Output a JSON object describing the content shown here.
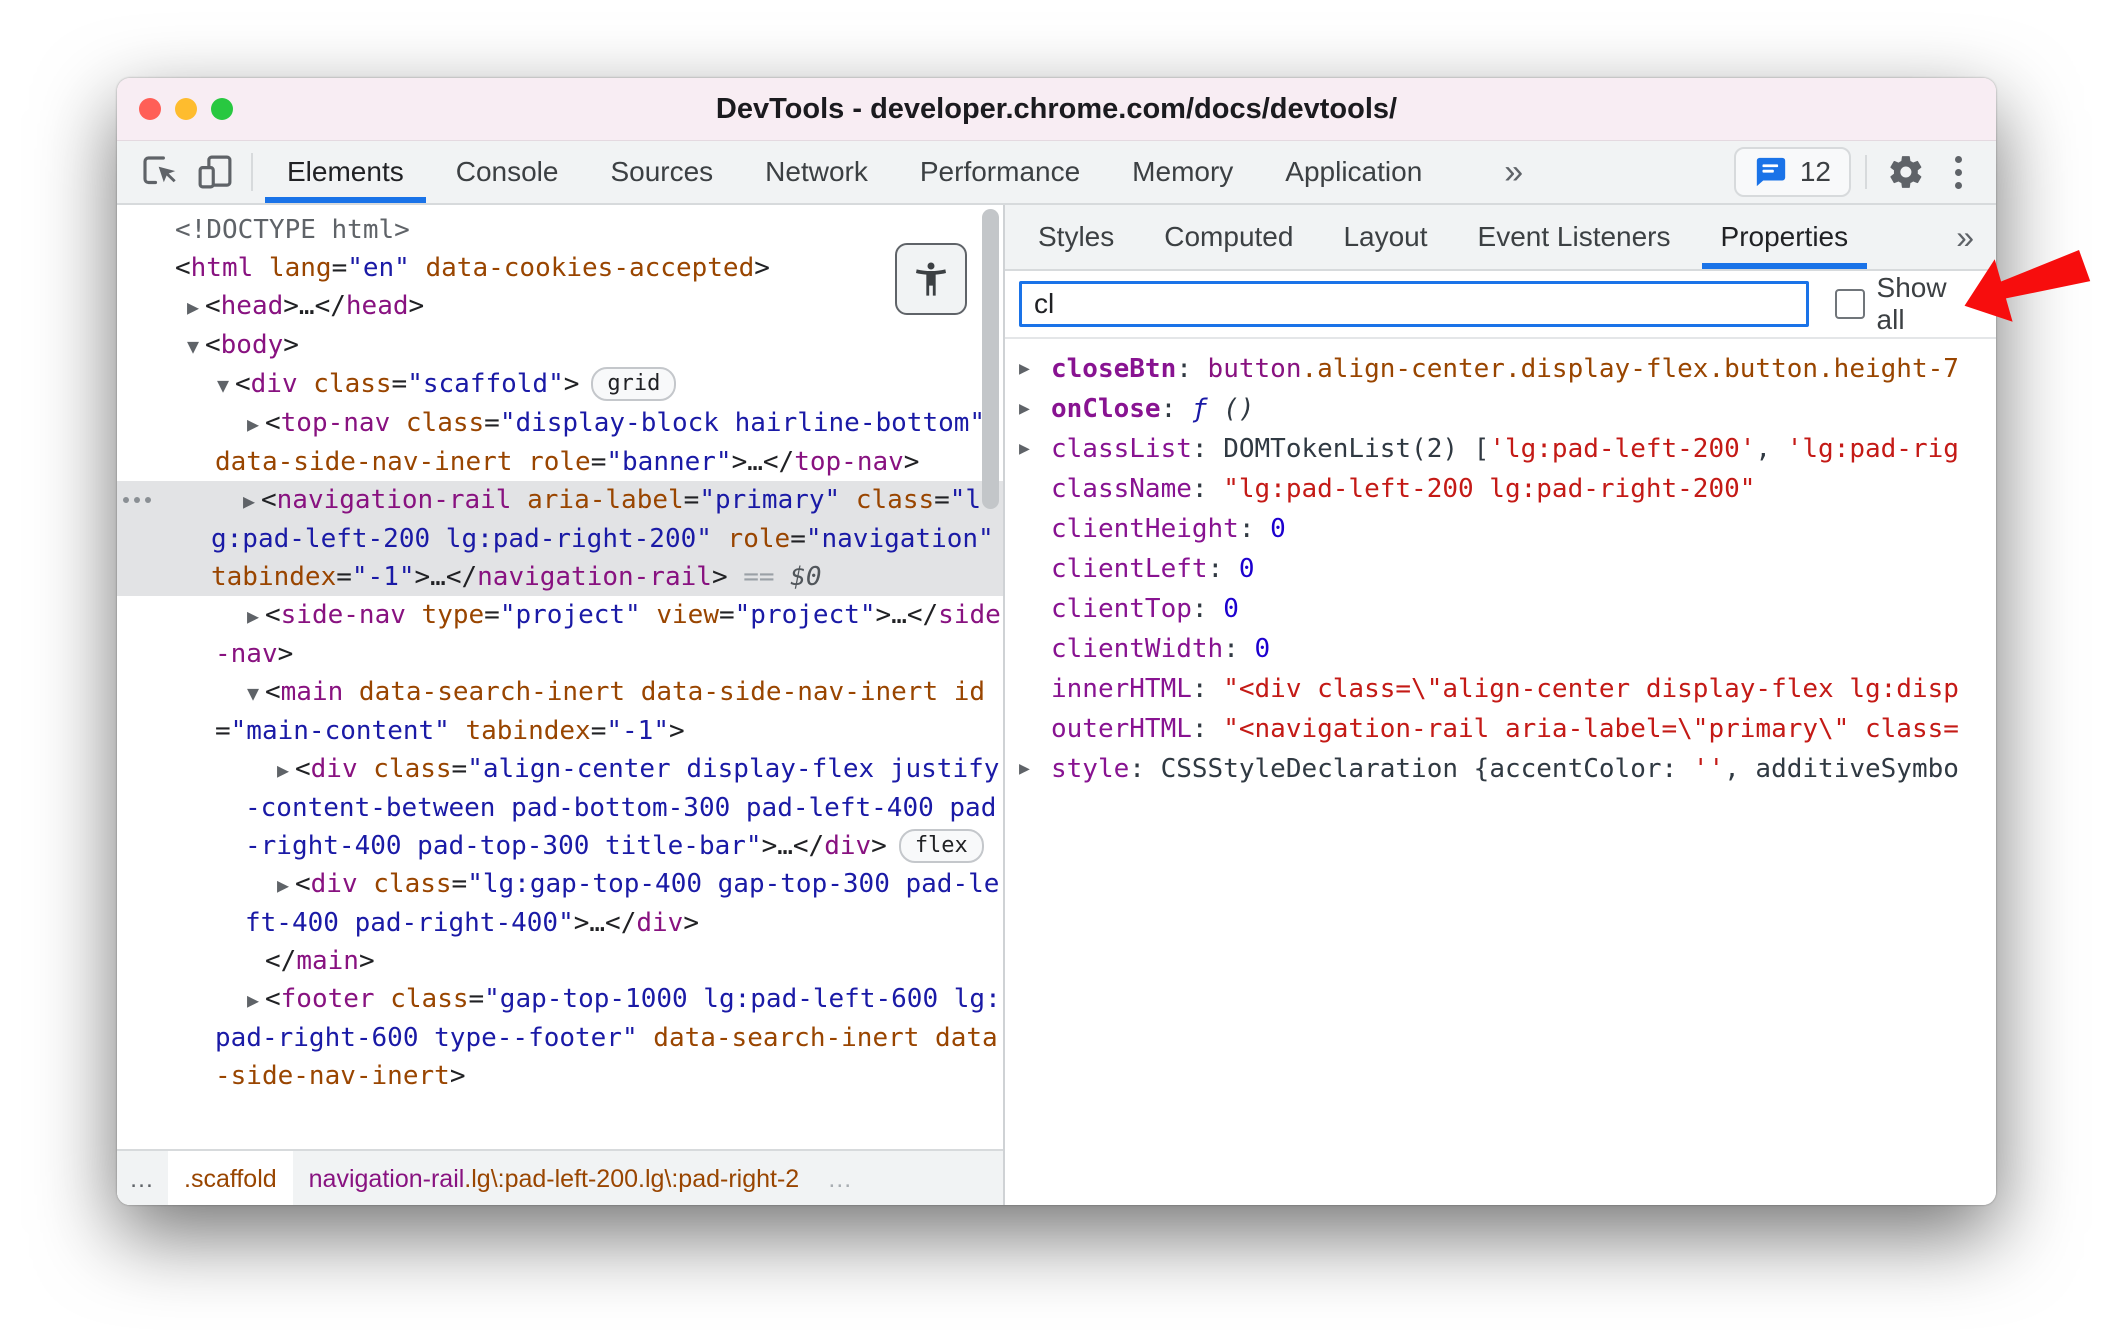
{
  "window": {
    "title": "DevTools - developer.chrome.com/docs/devtools/",
    "traffic_lights": [
      "close",
      "minimize",
      "zoom"
    ]
  },
  "devtools_toolbar": {
    "tabs": [
      "Elements",
      "Console",
      "Sources",
      "Network",
      "Performance",
      "Memory",
      "Application"
    ],
    "active_tab": "Elements",
    "more_tabs_glyph": "»",
    "messages_count": "12"
  },
  "elements_panel": {
    "tree": [
      {
        "level": 0,
        "arrow": "none",
        "parts": [
          [
            "g",
            "<!DOCTYPE html>"
          ]
        ]
      },
      {
        "level": 0,
        "arrow": "none",
        "parts": [
          [
            "p",
            "<"
          ],
          [
            "t",
            "html"
          ],
          [
            "a",
            " lang"
          ],
          [
            "p",
            "="
          ],
          [
            "v",
            "\"en\""
          ],
          [
            "a",
            " data-cookies-accepted"
          ],
          [
            "p",
            ">"
          ]
        ]
      },
      {
        "level": 1,
        "arrow": "closed",
        "parts": [
          [
            "p",
            "<"
          ],
          [
            "t",
            "head"
          ],
          [
            "p",
            ">…"
          ],
          [
            "p",
            "</"
          ],
          [
            "t",
            "head"
          ],
          [
            "p",
            ">"
          ]
        ]
      },
      {
        "level": 1,
        "arrow": "open",
        "parts": [
          [
            "p",
            "<"
          ],
          [
            "t",
            "body"
          ],
          [
            "p",
            ">"
          ]
        ]
      },
      {
        "level": 2,
        "arrow": "open",
        "badge": "grid",
        "parts": [
          [
            "p",
            "<"
          ],
          [
            "t",
            "div"
          ],
          [
            "a",
            " class"
          ],
          [
            "p",
            "="
          ],
          [
            "v",
            "\"scaffold\""
          ],
          [
            "p",
            ">"
          ]
        ]
      },
      {
        "level": 3,
        "arrow": "closed",
        "parts": [
          [
            "p",
            "<"
          ],
          [
            "t",
            "top-nav"
          ],
          [
            "a",
            " class"
          ],
          [
            "p",
            "="
          ],
          [
            "v",
            "\"display-block hairline-bottom\""
          ],
          [
            "a",
            " data-side-nav-inert"
          ],
          [
            "a",
            " role"
          ],
          [
            "p",
            "="
          ],
          [
            "v",
            "\"banner\""
          ],
          [
            "p",
            ">…"
          ],
          [
            "p",
            "</"
          ],
          [
            "t",
            "top-nav"
          ],
          [
            "p",
            ">"
          ]
        ]
      },
      {
        "level": 3,
        "arrow": "closed",
        "selected": true,
        "gutter": true,
        "suffix": [
          "==",
          "$0"
        ],
        "parts": [
          [
            "p",
            "<"
          ],
          [
            "t",
            "navigation-rail"
          ],
          [
            "a",
            " aria-label"
          ],
          [
            "p",
            "="
          ],
          [
            "v",
            "\"primary\""
          ],
          [
            "a",
            " class"
          ],
          [
            "p",
            "="
          ],
          [
            "v",
            "\"lg:pad-left-200 lg:pad-right-200\""
          ],
          [
            "a",
            " role"
          ],
          [
            "p",
            "="
          ],
          [
            "v",
            "\"navigation\""
          ],
          [
            "a",
            " tabindex"
          ],
          [
            "p",
            "="
          ],
          [
            "v",
            "\"-1\""
          ],
          [
            "p",
            ">…"
          ],
          [
            "p",
            "</"
          ],
          [
            "t",
            "navigation-rail"
          ],
          [
            "p",
            ">"
          ]
        ]
      },
      {
        "level": 3,
        "arrow": "closed",
        "parts": [
          [
            "p",
            "<"
          ],
          [
            "t",
            "side-nav"
          ],
          [
            "a",
            " type"
          ],
          [
            "p",
            "="
          ],
          [
            "v",
            "\"project\""
          ],
          [
            "a",
            " view"
          ],
          [
            "p",
            "="
          ],
          [
            "v",
            "\"project\""
          ],
          [
            "p",
            ">…"
          ],
          [
            "p",
            "</"
          ],
          [
            "t",
            "side-nav"
          ],
          [
            "p",
            ">"
          ]
        ]
      },
      {
        "level": 3,
        "arrow": "open",
        "parts": [
          [
            "p",
            "<"
          ],
          [
            "t",
            "main"
          ],
          [
            "a",
            " data-search-inert"
          ],
          [
            "a",
            " data-side-nav-inert"
          ],
          [
            "a",
            " id"
          ],
          [
            "p",
            "="
          ],
          [
            "v",
            "\"main-content\""
          ],
          [
            "a",
            " tabindex"
          ],
          [
            "p",
            "="
          ],
          [
            "v",
            "\"-1\""
          ],
          [
            "p",
            ">"
          ]
        ]
      },
      {
        "level": 4,
        "arrow": "closed",
        "badge": "flex",
        "parts": [
          [
            "p",
            "<"
          ],
          [
            "t",
            "div"
          ],
          [
            "a",
            " class"
          ],
          [
            "p",
            "="
          ],
          [
            "v",
            "\"align-center display-flex justify-content-between pad-bottom-300 pad-left-400 pad-right-400 pad-top-300 title-bar\""
          ],
          [
            "p",
            ">…"
          ],
          [
            "p",
            "</"
          ],
          [
            "t",
            "div"
          ],
          [
            "p",
            ">"
          ]
        ]
      },
      {
        "level": 4,
        "arrow": "closed",
        "parts": [
          [
            "p",
            "<"
          ],
          [
            "t",
            "div"
          ],
          [
            "a",
            " class"
          ],
          [
            "p",
            "="
          ],
          [
            "v",
            "\"lg:gap-top-400 gap-top-300 pad-left-400 pad-right-400\""
          ],
          [
            "p",
            ">…"
          ],
          [
            "p",
            "</"
          ],
          [
            "t",
            "div"
          ],
          [
            "p",
            ">"
          ]
        ]
      },
      {
        "level": 3,
        "arrow": "none",
        "parts": [
          [
            "p",
            "</"
          ],
          [
            "t",
            "main"
          ],
          [
            "p",
            ">"
          ]
        ]
      },
      {
        "level": 3,
        "arrow": "closed",
        "parts": [
          [
            "p",
            "<"
          ],
          [
            "t",
            "footer"
          ],
          [
            "a",
            " class"
          ],
          [
            "p",
            "="
          ],
          [
            "v",
            "\"gap-top-1000 lg:pad-left-600 lg:pad-right-600 type--footer\""
          ],
          [
            "a",
            " data-search-inert"
          ],
          [
            "a",
            " data-side-nav-inert"
          ],
          [
            "p",
            ">"
          ]
        ]
      }
    ],
    "breadcrumbs": {
      "items": [
        {
          "kind": "ellipsis",
          "text": "…"
        },
        {
          "kind": "crumb",
          "highlight": true,
          "parts": [
            [
              "a",
              ".scaffold"
            ]
          ]
        },
        {
          "kind": "crumb",
          "parts": [
            [
              "t",
              "navigation-rail"
            ],
            [
              "a",
              ".lg\\:pad-left-200.lg\\:pad-right-2"
            ]
          ]
        },
        {
          "kind": "ellipsis-muted",
          "text": "…"
        }
      ]
    }
  },
  "sidebar": {
    "tabs": [
      "Styles",
      "Computed",
      "Layout",
      "Event Listeners",
      "Properties"
    ],
    "active_tab": "Properties",
    "more_tabs_glyph": "»",
    "filter": {
      "value": "cl"
    },
    "show_all": {
      "label": "Show all",
      "checked": false
    },
    "properties": [
      {
        "name": "closeBtn",
        "own": true,
        "expandable": true,
        "value": [
          [
            "pv-t",
            "button"
          ],
          [
            "pv-a",
            ".align-center.display-flex.button.height-7"
          ]
        ]
      },
      {
        "name": "onClose",
        "own": true,
        "expandable": true,
        "value": [
          [
            "pv-fn",
            "ƒ"
          ],
          [
            "pv-di",
            " ()"
          ]
        ]
      },
      {
        "name": "classList",
        "expandable": true,
        "value": [
          [
            "pv-d",
            "DOMTokenList(2) ["
          ],
          [
            "pv-s",
            "'lg:pad-left-200'"
          ],
          [
            "pv-d",
            ", "
          ],
          [
            "pv-s",
            "'lg:pad-rig"
          ]
        ]
      },
      {
        "name": "className",
        "value": [
          [
            "pv-s",
            "\"lg:pad-left-200 lg:pad-right-200\""
          ]
        ]
      },
      {
        "name": "clientHeight",
        "value": [
          [
            "pv-n",
            "0"
          ]
        ]
      },
      {
        "name": "clientLeft",
        "value": [
          [
            "pv-n",
            "0"
          ]
        ]
      },
      {
        "name": "clientTop",
        "value": [
          [
            "pv-n",
            "0"
          ]
        ]
      },
      {
        "name": "clientWidth",
        "value": [
          [
            "pv-n",
            "0"
          ]
        ]
      },
      {
        "name": "innerHTML",
        "value": [
          [
            "pv-s",
            "\"<div class=\\\"align-center display-flex lg:disp"
          ]
        ]
      },
      {
        "name": "outerHTML",
        "value": [
          [
            "pv-s",
            "\"<navigation-rail aria-label=\\\"primary\\\" class="
          ]
        ]
      },
      {
        "name": "style",
        "expandable": true,
        "value": [
          [
            "pv-d",
            "CSSStyleDeclaration {accentColor: "
          ],
          [
            "pv-s",
            "''"
          ],
          [
            "pv-d",
            ", additiveSymbo"
          ]
        ]
      }
    ]
  },
  "colors": {
    "accent": "#1a73e8",
    "traffic": [
      "#ff5f57",
      "#febc2e",
      "#28c840"
    ],
    "annotation_arrow": "#f70d0d",
    "tag": "#881280",
    "attr_name": "#994500",
    "attr_value": "#1a1aa6",
    "string": "#c41a16",
    "number": "#1c00cf"
  }
}
